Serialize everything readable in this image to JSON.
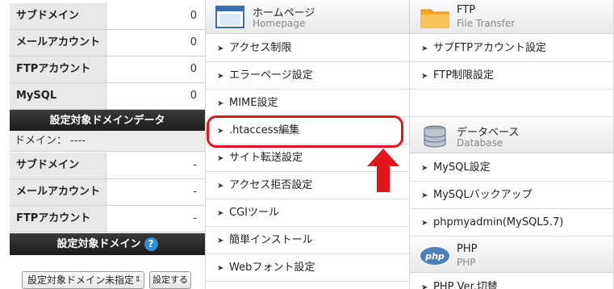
{
  "sidebar": {
    "top_stats": [
      {
        "label": "サブドメイン",
        "value": "0"
      },
      {
        "label": "メールアカウント",
        "value": "0"
      },
      {
        "label": "FTPアカウント",
        "value": "0"
      },
      {
        "label": "MySQL",
        "value": "0"
      }
    ],
    "target_data_heading": "設定対象ドメインデータ",
    "domain_line": "ドメイン： ----",
    "target_stats": [
      {
        "label": "サブドメイン",
        "value": "-"
      },
      {
        "label": "メールアカウント",
        "value": "-"
      },
      {
        "label": "FTPアカウント",
        "value": "-"
      }
    ],
    "target_domain_heading": "設定対象ドメイン",
    "help_glyph": "?",
    "domain_select_value": "設定対象ドメイン未指定",
    "set_button_label": "設定する"
  },
  "homepage": {
    "title": "ホームページ",
    "subtitle": "Homepage",
    "items": [
      "アクセス制限",
      "エラーページ設定",
      "MIME設定",
      ".htaccess編集",
      "サイト転送設定",
      "アクセス拒否設定",
      "CGIツール",
      "簡単インストール",
      "Webフォント設定"
    ]
  },
  "ftp": {
    "title": "FTP",
    "subtitle": "File Transfer",
    "items": [
      "サブFTPアカウント設定",
      "FTP制限設定"
    ]
  },
  "database": {
    "title": "データベース",
    "subtitle": "Database",
    "items": [
      "MySQL設定",
      "MySQLバックアップ",
      "phpmyadmin(MySQL5.7)"
    ]
  },
  "php": {
    "title": "PHP",
    "subtitle": "PHP",
    "logo_text": "php",
    "items": [
      "PHP Ver.切替"
    ]
  },
  "colors": {
    "highlight": "#e3141b",
    "help_icon": "#2f8dd6",
    "folder": "#f5a623"
  }
}
